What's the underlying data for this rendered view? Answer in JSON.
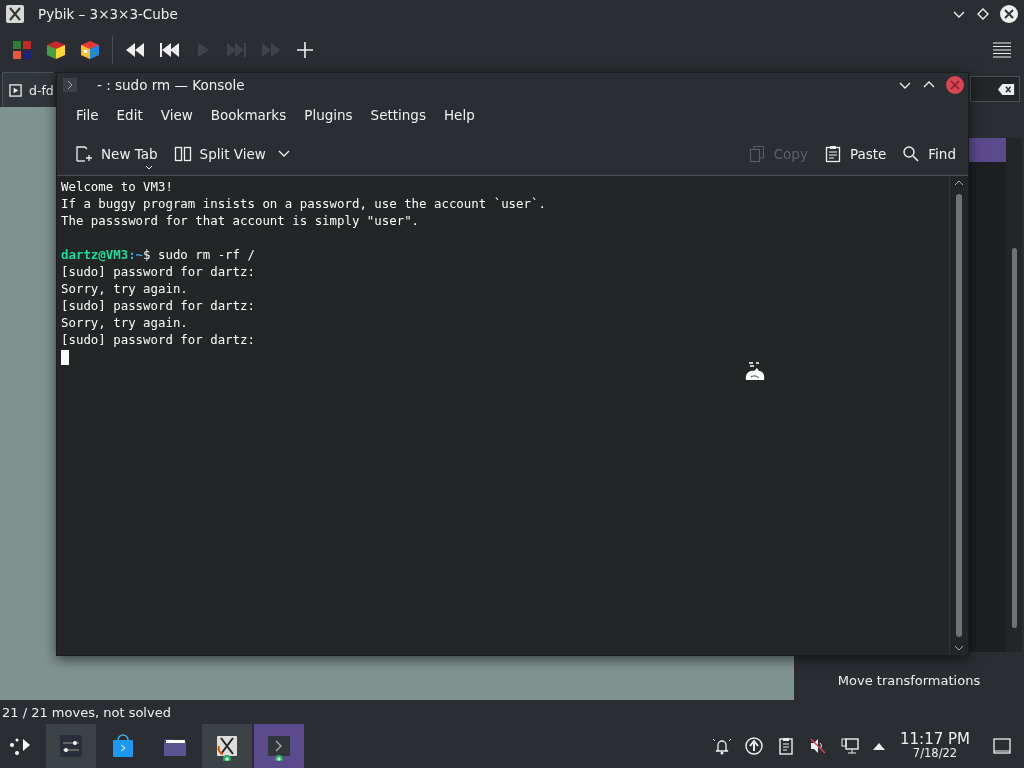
{
  "window": {
    "title": "Pybik – 3×3×3-Cube"
  },
  "toolbar": [
    {
      "kind": "cube-flat",
      "disabled": false
    },
    {
      "kind": "cube",
      "disabled": false
    },
    {
      "kind": "cube-scrambled",
      "disabled": false
    },
    {
      "kind": "rewind",
      "disabled": false
    },
    {
      "kind": "previous",
      "disabled": false
    },
    {
      "kind": "play",
      "disabled": true
    },
    {
      "kind": "next",
      "disabled": true
    },
    {
      "kind": "forward",
      "disabled": true
    },
    {
      "kind": "add",
      "disabled": false
    }
  ],
  "tab": {
    "label": "d-fd"
  },
  "side_panel": {
    "item_label": "Move transformations"
  },
  "status_bar": "21 / 21 moves, not solved",
  "konsole": {
    "title": "- : sudo rm — Konsole",
    "menu": [
      "File",
      "Edit",
      "View",
      "Bookmarks",
      "Plugins",
      "Settings",
      "Help"
    ],
    "toolbar": [
      {
        "kind": "new-tab",
        "label": "New Tab",
        "disabled": false
      },
      {
        "kind": "split",
        "label": "Split View",
        "disabled": false
      },
      {
        "kind": "copy",
        "label": "Copy",
        "disabled": true
      },
      {
        "kind": "paste",
        "label": "Paste",
        "disabled": false
      },
      {
        "kind": "find",
        "label": "Find",
        "disabled": false
      }
    ],
    "lines": [
      {
        "kind": "text",
        "text": "Welcome to VM3!"
      },
      {
        "kind": "text",
        "text": "If a buggy program insists on a password, use the account `user`."
      },
      {
        "kind": "text",
        "text": "The passsword for that account is simply \"user\"."
      },
      {
        "kind": "blank"
      },
      {
        "kind": "prompt",
        "user": "dartz@VM3",
        "path": ":~",
        "command": "$ sudo rm -rf /"
      },
      {
        "kind": "text",
        "text": "[sudo] password for dartz:"
      },
      {
        "kind": "text",
        "text": "Sorry, try again."
      },
      {
        "kind": "text",
        "text": "[sudo] password for dartz:"
      },
      {
        "kind": "text",
        "text": "Sorry, try again."
      },
      {
        "kind": "text",
        "text": "[sudo] password for dartz:"
      },
      {
        "kind": "cursor"
      }
    ]
  },
  "taskbar": {
    "tasks": [
      {
        "kind": "settings",
        "selected": false
      },
      {
        "kind": "store",
        "selected": false
      },
      {
        "kind": "folder",
        "selected": false
      },
      {
        "kind": "pybik",
        "selected": false
      },
      {
        "kind": "konsole",
        "selected": true
      }
    ],
    "time": "11:17 PM",
    "date": "7/18/22"
  }
}
